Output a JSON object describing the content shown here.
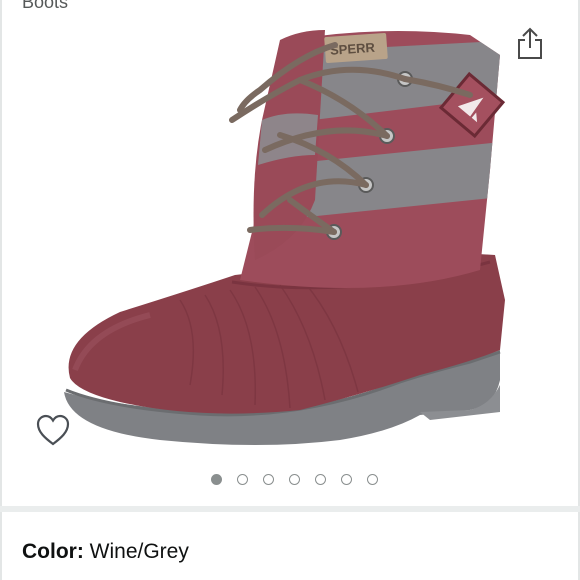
{
  "breadcrumb": {
    "text": "Boots"
  },
  "product": {
    "image_alt": "Wine and grey duck boot with striped wool shaft and leather laces",
    "icons": {
      "share": "share-icon",
      "wishlist": "heart-outline-icon"
    },
    "carousel": {
      "count": 7,
      "active_index": 1
    }
  },
  "variation": {
    "label": "Color:",
    "value": "Wine/Grey"
  },
  "colors": {
    "rubber": "#8a3f4a",
    "stripe_wine": "#a4505f",
    "stripe_grey": "#8d8c90",
    "sole": "#7f8185",
    "lace": "#7a6a60"
  }
}
